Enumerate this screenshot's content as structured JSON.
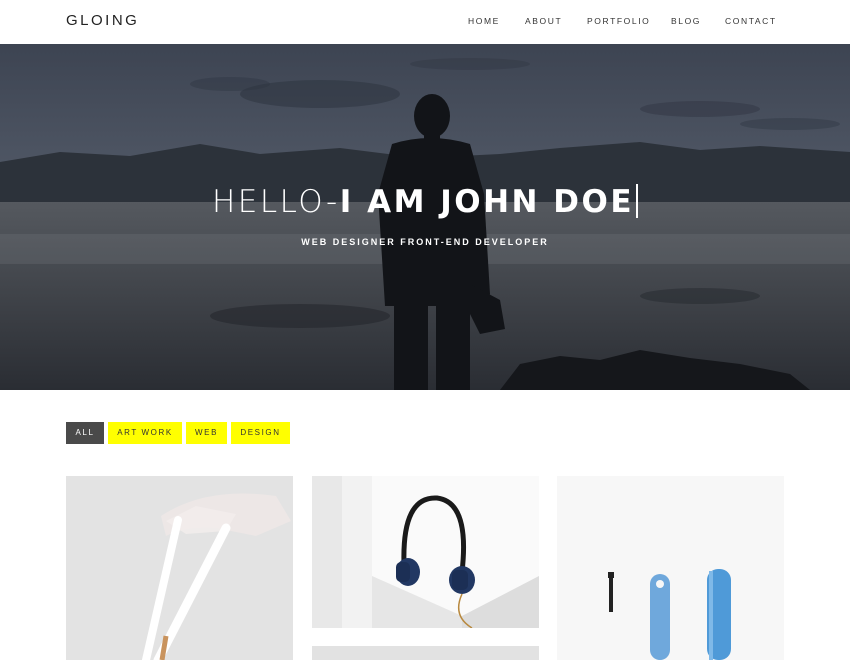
{
  "brand": {
    "logo": "GLOING"
  },
  "nav": {
    "home": "HOME",
    "about": "ABOUT",
    "portfolio": "PORTFOLIO",
    "blog": "BLOG",
    "contact": "CONTACT"
  },
  "hero": {
    "title_part1": "HELLO-",
    "title_part2": "I AM JOHN DOE",
    "subtitle": "WEB DESIGNER FRONT-END DEVELOPER"
  },
  "filters": {
    "all": "ALL",
    "art_work": "ART WORK",
    "web": "WEB",
    "design": "DESIGN"
  },
  "colors": {
    "accent": "#ffff00",
    "active_filter": "#4a4a4a"
  },
  "portfolio": {
    "items": [
      {
        "name": "white-pencils"
      },
      {
        "name": "headphones"
      },
      {
        "name": "blue-tools"
      }
    ]
  }
}
